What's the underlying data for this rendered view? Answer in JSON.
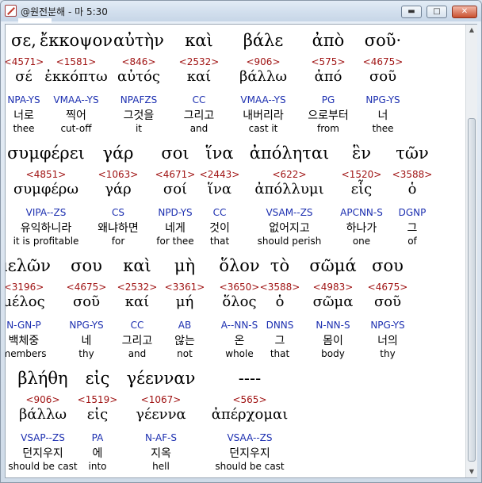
{
  "window": {
    "title": "@원전분해 - 마 5:30",
    "buttons": {
      "minimize": "▬",
      "maximize": "□",
      "close": "✕"
    }
  },
  "rows": [
    {
      "words": [
        {
          "greek": "σε,",
          "strong": "<4571>",
          "lemma": "σέ",
          "parse": "NPA-YS",
          "korean": "너로",
          "english": "thee"
        },
        {
          "greek": "ἔκκοψον",
          "strong": "<1581>",
          "lemma": "ἐκκόπτω",
          "parse": "VMAA--YS",
          "korean": "찍어",
          "english": "cut-off"
        },
        {
          "greek": "αὐτὴν",
          "strong": "<846>",
          "lemma": "αὐτός",
          "parse": "NPAFZS",
          "korean": "그것을",
          "english": "it"
        },
        {
          "greek": "καὶ",
          "strong": "<2532>",
          "lemma": "καί",
          "parse": "CC",
          "korean": "그리고",
          "english": "and"
        },
        {
          "greek": "βάλε",
          "strong": "<906>",
          "lemma": "βάλλω",
          "parse": "VMAA--YS",
          "korean": "내버리라",
          "english": "cast it"
        },
        {
          "greek": "ἀπὸ",
          "strong": "<575>",
          "lemma": "ἀπό",
          "parse": "PG",
          "korean": "으로부터",
          "english": "from"
        },
        {
          "greek": "σοῦ·",
          "strong": "<4675>",
          "lemma": "σοῦ",
          "parse": "NPG-YS",
          "korean": "너",
          "english": "thee"
        }
      ]
    },
    {
      "words": [
        {
          "greek": "συμφέρει",
          "strong": "<4851>",
          "lemma": "συμφέρω",
          "parse": "VIPA--ZS",
          "korean": "유익하니라",
          "english": "it is profitable"
        },
        {
          "greek": "γάρ",
          "strong": "<1063>",
          "lemma": "γάρ",
          "parse": "CS",
          "korean": "왜냐하면",
          "english": "for"
        },
        {
          "greek": "σοι",
          "strong": "<4671>",
          "lemma": "σοί",
          "parse": "NPD-YS",
          "korean": "네게",
          "english": "for thee"
        },
        {
          "greek": "ἵνα",
          "strong": "<2443>",
          "lemma": "ἵνα",
          "parse": "CC",
          "korean": "것이",
          "english": "that"
        },
        {
          "greek": "ἀπόληται",
          "strong": "<622>",
          "lemma": "ἀπόλλυμι",
          "parse": "VSAM--ZS",
          "korean": "없어지고",
          "english": "should perish"
        },
        {
          "greek": "ἓν",
          "strong": "<1520>",
          "lemma": "εἷς",
          "parse": "APCNN-S",
          "korean": "하나가",
          "english": "one"
        },
        {
          "greek": "τῶν",
          "strong": "<3588>",
          "lemma": "ὁ",
          "parse": "DGNP",
          "korean": "그",
          "english": "of"
        }
      ]
    },
    {
      "words": [
        {
          "greek": "μελῶν",
          "strong": "<3196>",
          "lemma": "μέλος",
          "parse": "N-GN-P",
          "korean": "백체중",
          "english": "members"
        },
        {
          "greek": "σου",
          "strong": "<4675>",
          "lemma": "σοῦ",
          "parse": "NPG-YS",
          "korean": "네",
          "english": "thy"
        },
        {
          "greek": "καὶ",
          "strong": "<2532>",
          "lemma": "καί",
          "parse": "CC",
          "korean": "그리고",
          "english": "and"
        },
        {
          "greek": "μὴ",
          "strong": "<3361>",
          "lemma": "μή",
          "parse": "AB",
          "korean": "않는",
          "english": "not"
        },
        {
          "greek": "ὅλον",
          "strong": "<3650>",
          "lemma": "ὅλος",
          "parse": "A--NN-S",
          "korean": "온",
          "english": "whole"
        },
        {
          "greek": "τὸ",
          "strong": "<3588>",
          "lemma": "ὁ",
          "parse": "DNNS",
          "korean": "그",
          "english": "that"
        },
        {
          "greek": "σῶμά",
          "strong": "<4983>",
          "lemma": "σῶμα",
          "parse": "N-NN-S",
          "korean": "몸이",
          "english": "body"
        },
        {
          "greek": "σου",
          "strong": "<4675>",
          "lemma": "σοῦ",
          "parse": "NPG-YS",
          "korean": "너의",
          "english": "thy"
        }
      ]
    },
    {
      "words": [
        {
          "greek": "βλήθη",
          "strong": "<906>",
          "lemma": "βάλλω",
          "parse": "VSAP--ZS",
          "korean": "던지우지",
          "english": "should be cast"
        },
        {
          "greek": "εἰς",
          "strong": "<1519>",
          "lemma": "εἰς",
          "parse": "PA",
          "korean": "에",
          "english": "into"
        },
        {
          "greek": "γέενναν",
          "strong": "<1067>",
          "lemma": "γέεννα",
          "parse": "N-AF-S",
          "korean": "지옥",
          "english": "hell"
        },
        {
          "greek": "----",
          "strong": "<565>",
          "lemma": "ἀπέρχομαι",
          "parse": "VSAA--ZS",
          "korean": "던지우지",
          "english": "should be cast"
        }
      ]
    }
  ]
}
